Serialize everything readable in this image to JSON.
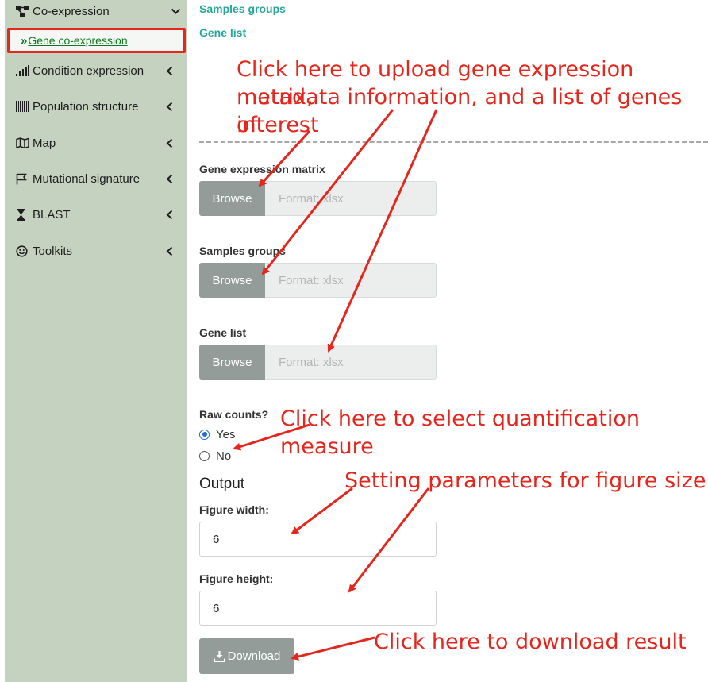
{
  "sidebar": {
    "items": [
      {
        "label": "Co-expression",
        "icon": "network-icon",
        "chevron": "chevron-down-icon"
      },
      {
        "label": "Gene co-expression",
        "icon": "double-chevron-right-icon",
        "active": true
      },
      {
        "label": "Condition expression",
        "icon": "signal-bars-icon",
        "chevron": "chevron-left-icon"
      },
      {
        "label": "Population structure",
        "icon": "barcode-icon",
        "chevron": "chevron-left-icon"
      },
      {
        "label": "Map",
        "icon": "map-icon",
        "chevron": "chevron-left-icon"
      },
      {
        "label": "Mutational signature",
        "icon": "flag-icon",
        "chevron": "chevron-left-icon"
      },
      {
        "label": "BLAST",
        "icon": "hourglass-icon",
        "chevron": "chevron-left-icon"
      },
      {
        "label": "Toolkits",
        "icon": "smile-icon",
        "chevron": "chevron-left-icon"
      }
    ]
  },
  "main": {
    "top_links": [
      "Samples groups",
      "Gene list"
    ],
    "uploads": [
      {
        "label": "Gene expression matrix",
        "button": "Browse",
        "placeholder": "Format: xlsx"
      },
      {
        "label": "Samples groups",
        "button": "Browse",
        "placeholder": "Format: xlsx"
      },
      {
        "label": "Gene list",
        "button": "Browse",
        "placeholder": "Format: xlsx"
      }
    ],
    "raw_counts": {
      "label": "Raw counts?",
      "options": [
        {
          "label": "Yes",
          "selected": true
        },
        {
          "label": "No",
          "selected": false
        }
      ]
    },
    "output": {
      "heading": "Output",
      "width_label": "Figure width:",
      "width_value": "6",
      "height_label": "Figure height:",
      "height_value": "6",
      "download_label": "Download"
    }
  },
  "annotations": {
    "upload_lines": [
      "Click here to upload gene expression matrix,",
      "metadata information, and a list of genes of",
      "interest"
    ],
    "quantification": "Click here to select quantification measure",
    "figure_size": "Setting parameters for figure size",
    "download": "Click here to download result"
  },
  "colors": {
    "sidebar_bg": "#c5d2c0",
    "accent_teal": "#26a79b",
    "annotation_red": "#e4261d",
    "button_gray": "#939c99",
    "active_link_green": "#0f7a20"
  }
}
